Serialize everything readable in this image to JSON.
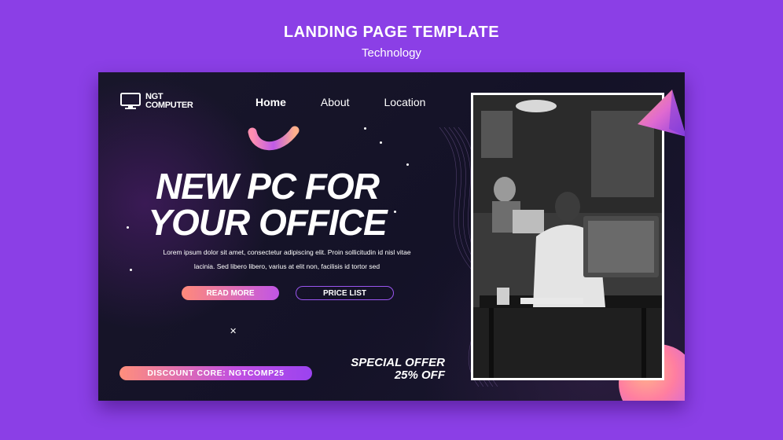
{
  "header": {
    "title": "LANDING PAGE TEMPLATE",
    "subtitle": "Technology"
  },
  "logo": {
    "line1": "NGT",
    "line2": "COMPUTER",
    "icon": "monitor-icon"
  },
  "nav": {
    "items": [
      {
        "label": "Home",
        "active": true
      },
      {
        "label": "About",
        "active": false
      },
      {
        "label": "Location",
        "active": false
      }
    ]
  },
  "hero": {
    "line1": "NEW PC FOR",
    "line2": "YOUR OFFICE",
    "body_line1": "Lorem ipsum dolor sit amet, consectetur adipiscing elit. Proin sollicitudin id nisl vitae",
    "body_line2": "lacinia. Sed libero libero, varius at elit non, facilisis id tortor sed"
  },
  "buttons": {
    "read_more": "READ MORE",
    "price_list": "PRICE LIST"
  },
  "promo": {
    "discount": "DISCOUNT CORE: NGTCOMP25",
    "offer_line1": "SPECIAL OFFER",
    "offer_line2": "25% OFF"
  },
  "colors": {
    "background": "#8b3fe6",
    "card": "#16142a",
    "accent_start": "#ff8a7a",
    "accent_end": "#c155e6"
  }
}
